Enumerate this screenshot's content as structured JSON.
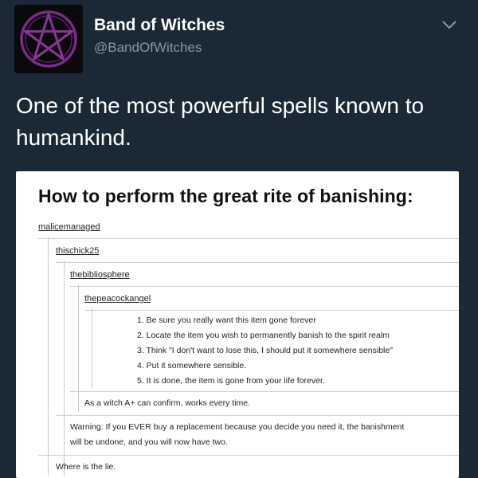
{
  "account": {
    "display_name": "Band of Witches",
    "handle": "@BandOfWitches",
    "avatar_icon": "pentagram-icon",
    "menu_icon": "chevron-down-icon"
  },
  "tweet": {
    "text": "One of the most powerful spells known to humankind."
  },
  "post": {
    "title": "How to perform the great rite of banishing:",
    "users": [
      "malicemanaged",
      "thischick25",
      "thebibliosphere",
      "thepeacockangel"
    ],
    "steps": [
      "1. Be sure you really want this item gone forever",
      "2. Locate the item you wish to permanently banish to the spirit realm",
      "3. Think \"I don't want to lose this, I should put it somewhere sensible\"",
      "4. Put it somewhere sensible.",
      "5. It is done, the item is gone from your life forever."
    ],
    "reply_1": "As a witch A+ can confirm, works every time.",
    "reply_2_line1": "Warning: If you EVER buy a replacement because you decide you need it, the banishment",
    "reply_2_line2": "will be undone, and you will now have two.",
    "reply_3": "Where is the lie."
  },
  "colors": {
    "background": "#1b2836",
    "avatar_symbol": "#7a2a8a",
    "handle": "#8899a6"
  }
}
